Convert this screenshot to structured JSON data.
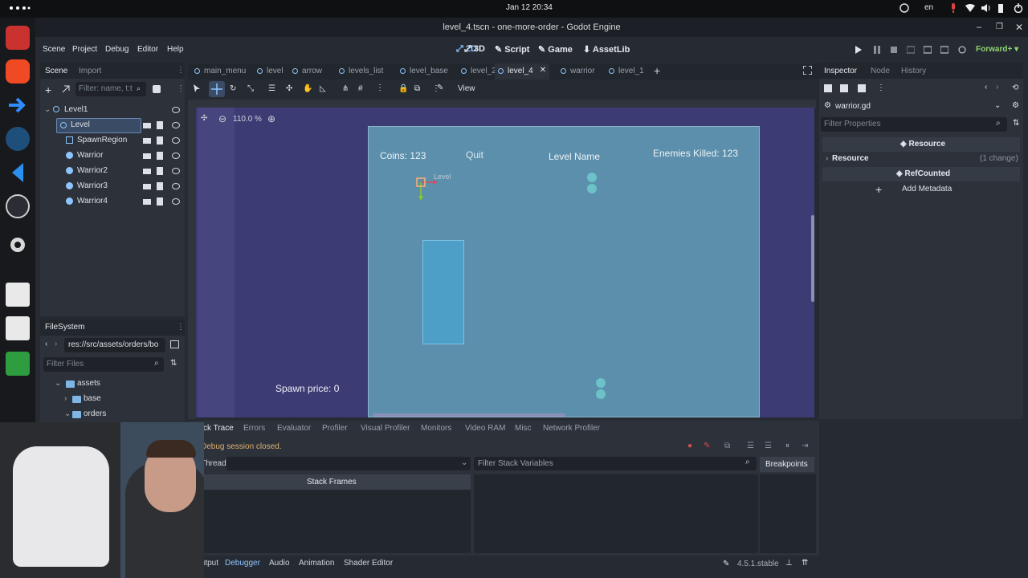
{
  "system": {
    "clock": "Jan 12  20:34",
    "lang": "en"
  },
  "window": {
    "title": "level_4.tscn - one-more-order - Godot Engine"
  },
  "menu": {
    "items": [
      "Scene",
      "Project",
      "Debug",
      "Editor",
      "Help"
    ]
  },
  "workspaces": [
    {
      "label": "2D",
      "active": true
    },
    {
      "label": "3D"
    },
    {
      "label": "Script"
    },
    {
      "label": "Game"
    },
    {
      "label": "AssetLib"
    }
  ],
  "renderer": "Forward+",
  "scene_dock": {
    "tabs": [
      "Scene",
      "Import"
    ],
    "filter_placeholder": "Filter: name, t:t",
    "tree": [
      {
        "label": "Level1",
        "depth": 0
      },
      {
        "label": "Level",
        "depth": 1,
        "selected": true
      },
      {
        "label": "SpawnRegion",
        "depth": 1
      },
      {
        "label": "Warrior",
        "depth": 1
      },
      {
        "label": "Warrior2",
        "depth": 1
      },
      {
        "label": "Warrior3",
        "depth": 1
      },
      {
        "label": "Warrior4",
        "depth": 1
      }
    ]
  },
  "filesystem": {
    "title": "FileSystem",
    "path": "res://src/assets/orders/bo",
    "filter_placeholder": "Filter Files",
    "items": [
      {
        "label": "assets",
        "depth": 0
      },
      {
        "label": "base",
        "depth": 1
      },
      {
        "label": "orders",
        "depth": 1
      }
    ]
  },
  "scene_tabs": [
    "main_menu",
    "level",
    "arrow",
    "levels_list",
    "level_base",
    "level_2",
    "level_4",
    "warrior",
    "level_1"
  ],
  "active_scene_tab": "level_4",
  "toolbar": {
    "view_label": "View"
  },
  "viewport": {
    "zoom": "110.0 %",
    "game_ui": {
      "coins": "Coins: 123",
      "quit": "Quit",
      "level_name": "Level Name",
      "enemies": "Enemies Killed:  123",
      "spawn_price": "Spawn price: 0",
      "node_label": "Level"
    }
  },
  "inspector": {
    "tabs": [
      "Inspector",
      "Node",
      "History"
    ],
    "resource_file": "warrior.gd",
    "filter_placeholder": "Filter Properties",
    "section_resource": "Resource",
    "resource_label": "Resource",
    "resource_changes": "(1 change)",
    "section_refcounted": "RefCounted",
    "add_metadata": "Add Metadata"
  },
  "debugger": {
    "tabs": [
      "Stack Trace",
      "Errors",
      "Evaluator",
      "Profiler",
      "Visual Profiler",
      "Monitors",
      "Video RAM",
      "Misc",
      "Network Profiler"
    ],
    "status": "Debug session closed.",
    "thread_label": "Thread:",
    "stack_var_placeholder": "Filter Stack Variables",
    "breakpoints": "Breakpoints",
    "stack_frames": "Stack Frames"
  },
  "bottom_tabs": [
    "Output",
    "Debugger",
    "Audio",
    "Animation",
    "Shader Editor"
  ],
  "version": "4.5.1.stable",
  "colors": {
    "accent": "#8ec5ff",
    "viewport": "#3c3b74",
    "game_bg": "#5b8fac"
  }
}
